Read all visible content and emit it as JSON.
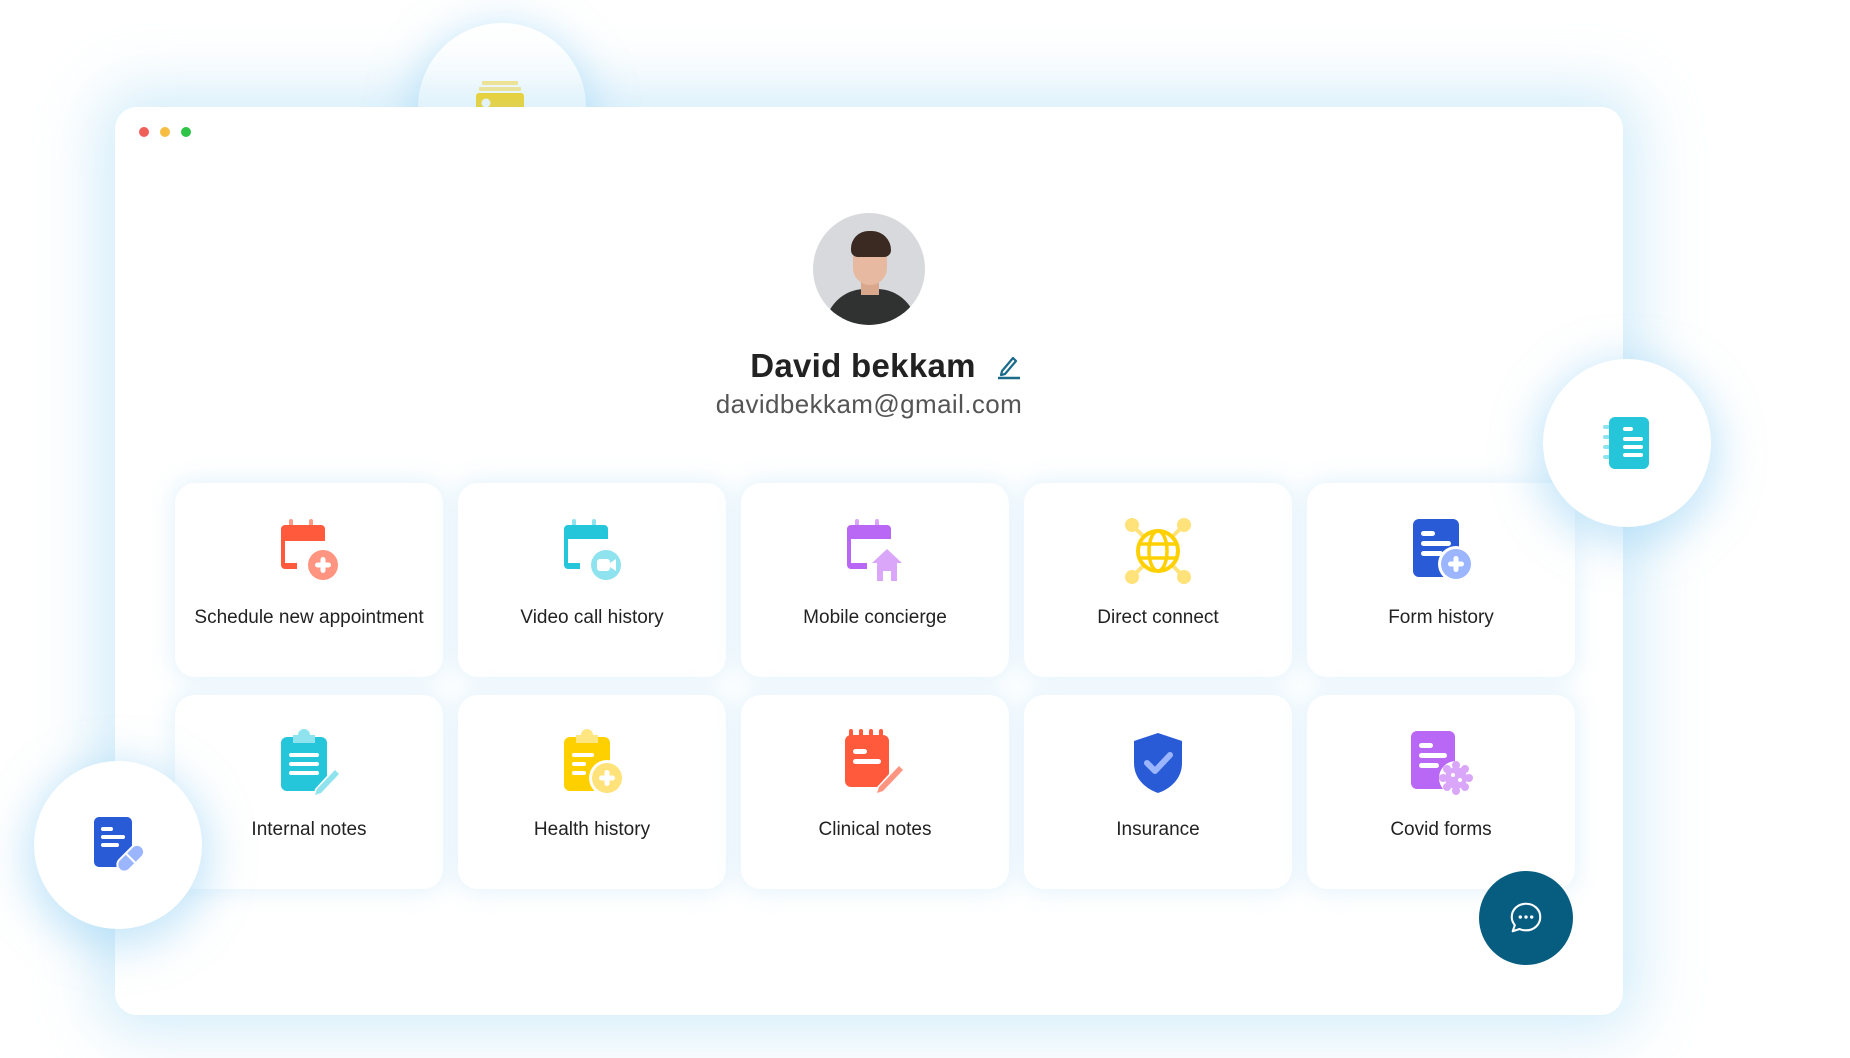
{
  "window": {
    "controls": [
      "close",
      "minimize",
      "maximize"
    ],
    "control_colors": {
      "close": "#f0605a",
      "minimize": "#f6bd43",
      "maximize": "#2ec449"
    }
  },
  "profile": {
    "avatar_alt": "Profile photo of David bekkam",
    "name": "David bekkam",
    "email": "davidbekkam@gmail.com",
    "edit_icon": "pencil-icon",
    "accent_color": "#1a6a8a"
  },
  "actions": [
    {
      "label": "Schedule new appointment",
      "icon": "calendar-plus-icon",
      "color": "#ff5a3c"
    },
    {
      "label": "Video call history",
      "icon": "calendar-video-icon",
      "color": "#26c6da"
    },
    {
      "label": "Mobile concierge",
      "icon": "calendar-home-icon",
      "color": "#b968f5"
    },
    {
      "label": "Direct connect",
      "icon": "globe-network-icon",
      "color": "#ffd000"
    },
    {
      "label": "Form history",
      "icon": "document-plus-icon",
      "color": "#2a5bd7"
    },
    {
      "label": "Internal notes",
      "icon": "clipboard-pencil-icon",
      "color": "#26c6da"
    },
    {
      "label": "Health history",
      "icon": "clipboard-plus-icon",
      "color": "#ffd000"
    },
    {
      "label": "Clinical notes",
      "icon": "notepad-pencil-icon",
      "color": "#ff5a3c"
    },
    {
      "label": "Insurance",
      "icon": "shield-check-icon",
      "color": "#2a5bd7"
    },
    {
      "label": "Covid forms",
      "icon": "document-virus-icon",
      "color": "#b968f5"
    }
  ],
  "floating_icons": [
    {
      "name": "image-gallery-icon",
      "color": "#ffd000"
    },
    {
      "name": "notebook-icon",
      "color": "#26c6da"
    },
    {
      "name": "prescription-icon",
      "color": "#2a5bd7"
    }
  ],
  "chat": {
    "icon": "chat-bubble-icon",
    "color": "#075d80"
  }
}
